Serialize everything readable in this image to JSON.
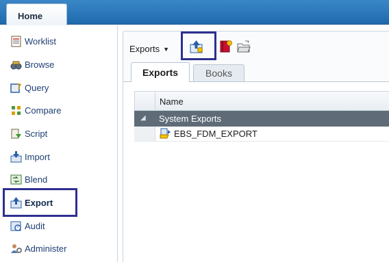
{
  "header": {
    "home_tab": "Home"
  },
  "sidebar": {
    "items": [
      {
        "label": "Worklist",
        "icon": "worklist-icon"
      },
      {
        "label": "Browse",
        "icon": "browse-icon"
      },
      {
        "label": "Query",
        "icon": "query-icon"
      },
      {
        "label": "Compare",
        "icon": "compare-icon"
      },
      {
        "label": "Script",
        "icon": "script-icon"
      },
      {
        "label": "Import",
        "icon": "import-icon"
      },
      {
        "label": "Blend",
        "icon": "blend-icon"
      },
      {
        "label": "Export",
        "icon": "export-icon",
        "active": true
      },
      {
        "label": "Audit",
        "icon": "audit-icon"
      },
      {
        "label": "Administer",
        "icon": "administer-icon"
      }
    ]
  },
  "toolbar": {
    "exports_menu": "Exports",
    "icons": [
      "new-export-icon",
      "new-book-icon",
      "open-folder-icon"
    ]
  },
  "tabs": [
    {
      "label": "Exports",
      "active": true
    },
    {
      "label": "Books",
      "active": false
    }
  ],
  "grid": {
    "column_name": "Name",
    "group": "System Exports",
    "rows": [
      {
        "name": "EBS_FDM_EXPORT"
      }
    ]
  },
  "colors": {
    "topbar": "#2a7abf",
    "highlight_border": "#2e2f8f",
    "group_row": "#5f6c78",
    "nav_text": "#1d3f72"
  }
}
